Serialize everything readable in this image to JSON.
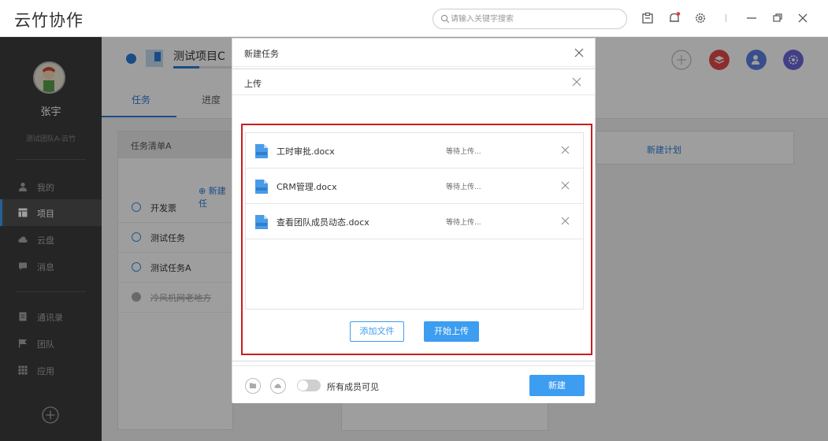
{
  "app": {
    "title": "云竹协作"
  },
  "search": {
    "placeholder": "请输入关键字搜索"
  },
  "user": {
    "name": "张宇",
    "team": "测试团队A-云竹"
  },
  "sidebar": {
    "items": [
      {
        "label": "我的",
        "icon": "person-icon"
      },
      {
        "label": "项目",
        "icon": "project-icon",
        "active": true
      },
      {
        "label": "云盘",
        "icon": "cloud-icon"
      },
      {
        "label": "消息",
        "icon": "message-icon"
      },
      {
        "label": "通讯录",
        "icon": "contacts-icon"
      },
      {
        "label": "团队",
        "icon": "flag-icon"
      },
      {
        "label": "应用",
        "icon": "grid-icon"
      }
    ]
  },
  "project": {
    "title": "测试项目C",
    "progress_percent": 45
  },
  "tabs": [
    {
      "label": "任务",
      "active": true
    },
    {
      "label": "进度"
    }
  ],
  "board": {
    "list_title": "任务清单A",
    "new_task": "新建任",
    "tasks": [
      {
        "label": "开发票",
        "done": false
      },
      {
        "label": "测试任务",
        "done": false
      },
      {
        "label": "测试任务A",
        "done": false
      },
      {
        "label": "冷风机网老地方",
        "done": true
      }
    ],
    "new_plan": "新建计划"
  },
  "dialog_new_task": {
    "title": "新建任务",
    "footer": {
      "visibility_label": "所有成员可见",
      "create_button": "新建"
    }
  },
  "dialog_upload": {
    "title": "上传",
    "files": [
      {
        "name": "工时审批.docx",
        "status": "等待上传..."
      },
      {
        "name": "CRM管理.docx",
        "status": "等待上传..."
      },
      {
        "name": "查看团队成员动态.docx",
        "status": "等待上传..."
      }
    ],
    "add_button": "添加文件",
    "start_button": "开始上传"
  },
  "colors": {
    "accent": "#3d9df0",
    "highlight": "#cc1c1c",
    "sidebar": "#3d3d3d"
  }
}
